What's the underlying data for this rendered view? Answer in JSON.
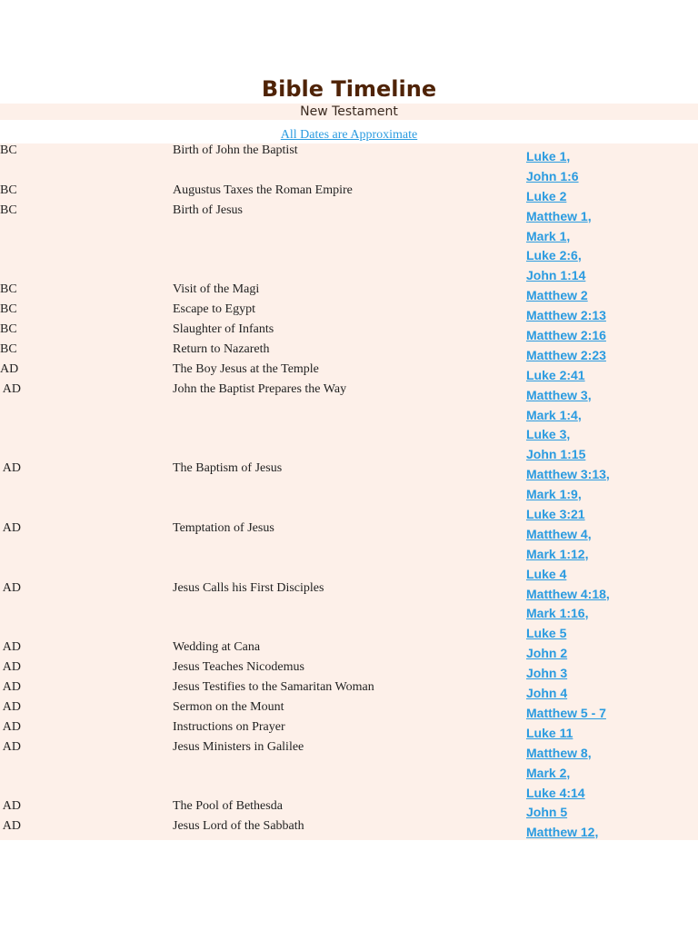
{
  "title": "Bible Timeline",
  "subtitle": "New Testament",
  "note": "All Dates are Approximate",
  "rows": [
    {
      "date": "BC",
      "event": "Birth of John the Baptist",
      "refs": [
        {
          "t": "Luke 1",
          "c": ","
        },
        {
          "t": "John 1:6",
          "c": ""
        }
      ]
    },
    {
      "date": "BC",
      "event": "Augustus Taxes the Roman Empire",
      "refs": [
        {
          "t": "Luke 2",
          "c": ""
        }
      ]
    },
    {
      "date": "BC",
      "event": "Birth of Jesus",
      "refs": [
        {
          "t": "Matthew 1",
          "c": ","
        },
        {
          "t": "Mark 1",
          "c": ","
        },
        {
          "t": "Luke 2:6",
          "c": ","
        },
        {
          "t": "John 1:14",
          "c": ""
        }
      ]
    },
    {
      "date": "BC",
      "event": "Visit of the Magi",
      "refs": [
        {
          "t": "Matthew 2",
          "c": ""
        }
      ]
    },
    {
      "date": "BC",
      "event": "Escape to Egypt",
      "refs": [
        {
          "t": "Matthew 2:13",
          "c": ""
        }
      ]
    },
    {
      "date": "BC",
      "event": "Slaughter of Infants",
      "refs": [
        {
          "t": "Matthew 2:16",
          "c": ""
        }
      ]
    },
    {
      "date": "BC",
      "event": "Return to Nazareth",
      "refs": [
        {
          "t": "Matthew 2:23",
          "c": ""
        }
      ]
    },
    {
      "date": "AD",
      "event": "The Boy Jesus at the Temple",
      "refs": [
        {
          "t": "Luke 2:41",
          "c": ""
        }
      ]
    },
    {
      "date": " AD",
      "event": "John the Baptist Prepares the Way",
      "refs": [
        {
          "t": "Matthew 3",
          "c": ","
        },
        {
          "t": "Mark 1:4",
          "c": ","
        },
        {
          "t": "Luke 3",
          "c": ","
        },
        {
          "t": "John 1:15",
          "c": ""
        }
      ]
    },
    {
      "date": " AD",
      "event": "The Baptism of Jesus",
      "refs": [
        {
          "t": "Matthew 3:13",
          "c": ","
        },
        {
          "t": "Mark 1:9",
          "c": ","
        },
        {
          "t": "Luke 3:21",
          "c": ""
        }
      ]
    },
    {
      "date": " AD",
      "event": "Temptation of Jesus",
      "refs": [
        {
          "t": "Matthew 4",
          "c": ","
        },
        {
          "t": "Mark 1:12",
          "c": ","
        },
        {
          "t": "Luke 4",
          "c": ""
        }
      ]
    },
    {
      "date": " AD",
      "event": "Jesus Calls his First Disciples",
      "refs": [
        {
          "t": "Matthew 4:18",
          "c": ","
        },
        {
          "t": "Mark 1:16",
          "c": ","
        },
        {
          "t": "Luke 5",
          "c": ""
        }
      ]
    },
    {
      "date": " AD",
      "event": "Wedding at Cana",
      "refs": [
        {
          "t": "John 2",
          "c": ""
        }
      ]
    },
    {
      "date": " AD",
      "event": "Jesus Teaches Nicodemus",
      "refs": [
        {
          "t": "John 3",
          "c": ""
        }
      ]
    },
    {
      "date": " AD",
      "event": "Jesus Testifies to the Samaritan Woman",
      "refs": [
        {
          "t": "John 4",
          "c": ""
        }
      ]
    },
    {
      "date": " AD",
      "event": "Sermon on the Mount",
      "refs": [
        {
          "t": "Matthew 5 - 7",
          "c": ""
        }
      ]
    },
    {
      "date": " AD",
      "event": "Instructions on Prayer",
      "refs": [
        {
          "t": "Luke 11",
          "c": ""
        }
      ]
    },
    {
      "date": " AD",
      "event": "Jesus Ministers in Galilee",
      "refs": [
        {
          "t": "Matthew 8",
          "c": ","
        },
        {
          "t": "Mark 2",
          "c": ","
        },
        {
          "t": "Luke 4:14",
          "c": ""
        }
      ]
    },
    {
      "date": " AD",
      "event": "The Pool of Bethesda",
      "refs": [
        {
          "t": "John 5",
          "c": ""
        }
      ]
    },
    {
      "date": " AD",
      "event": "Jesus Lord of the Sabbath",
      "refs": [
        {
          "t": "Matthew 12",
          "c": ","
        }
      ]
    }
  ]
}
